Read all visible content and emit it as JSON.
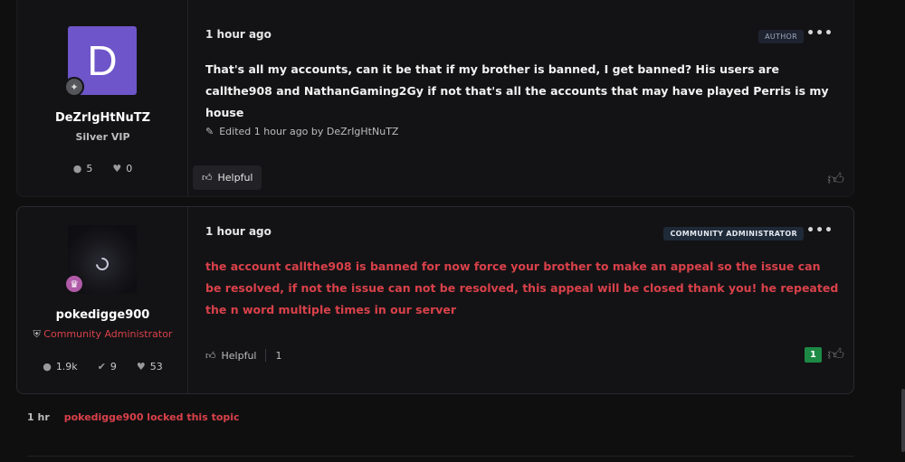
{
  "posts": [
    {
      "author": {
        "avatar_letter": "D",
        "username": "DeZrIgHtNuTZ",
        "title": "Silver VIP",
        "posts": "5",
        "likes": "0"
      },
      "timestamp": "1 hour ago",
      "role_badge": "AUTHOR",
      "body": "That's all my accounts, can it be that if my brother is banned, I get banned? His users are callthe908 and NathanGaming2Gy if not that's all the accounts that may have played Perris is my house",
      "edited": "Edited 1 hour ago by DeZrIgHtNuTZ",
      "helpful_label": "Helpful"
    },
    {
      "author": {
        "username": "pokedigge900",
        "title": "Community Administrator",
        "posts": "1.9k",
        "solutions": "9",
        "likes": "53"
      },
      "timestamp": "1 hour ago",
      "role_badge": "COMMUNITY ADMINISTRATOR",
      "body": "the account callthe908 is banned for now force your brother to make an appeal so the issue can be resolved, if not the issue can not be resolved, this appeal will be closed thank you! he repeated the n word multiple times in our server",
      "helpful_label": "Helpful",
      "helpful_count": "1",
      "score": "1"
    }
  ],
  "activity": {
    "time": "1 hr",
    "text": "pokedigge900 locked this topic"
  },
  "colors": {
    "accent_red": "#d9414a",
    "avatar_purple": "#6e55c9",
    "score_green": "#1c8a45"
  }
}
